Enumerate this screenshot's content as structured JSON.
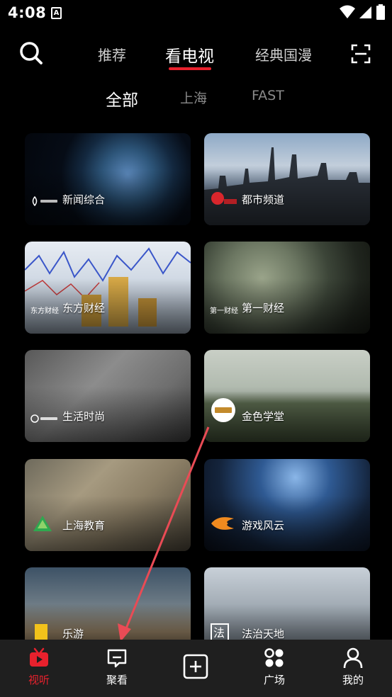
{
  "status": {
    "time": "4:08",
    "notif_letter": "A",
    "icons": [
      "wifi-icon",
      "signal-icon",
      "battery-icon"
    ]
  },
  "top_nav": {
    "tabs": [
      {
        "label": "推荐",
        "active": false
      },
      {
        "label": "看电视",
        "active": true
      },
      {
        "label": "经典国漫",
        "active": false
      }
    ],
    "accent": "#e8212d"
  },
  "sub_nav": {
    "tabs": [
      {
        "label": "全部",
        "active": true
      },
      {
        "label": "上海",
        "active": false
      },
      {
        "label": "FAST",
        "active": false
      }
    ]
  },
  "channels": [
    {
      "name": "新闻综合",
      "logo_text": "新闻综合"
    },
    {
      "name": "都市频道",
      "logo_text": "都市"
    },
    {
      "name": "东方财经",
      "logo_text": "东方财经"
    },
    {
      "name": "第一财经",
      "logo_text": "第一财经"
    },
    {
      "name": "生活时尚",
      "logo_text": "生活时尚"
    },
    {
      "name": "金色学堂",
      "logo_text": "金色学堂"
    },
    {
      "name": "上海教育",
      "logo_text": ""
    },
    {
      "name": "游戏风云",
      "logo_text": ""
    },
    {
      "name": "乐游",
      "logo_text": ""
    },
    {
      "name": "法治天地",
      "logo_text": "法"
    }
  ],
  "bottom_nav": [
    {
      "label": "视听",
      "active": true,
      "icon": "tv-icon"
    },
    {
      "label": "聚看",
      "active": false,
      "icon": "chat-icon"
    },
    {
      "label": "",
      "active": false,
      "icon": "add-icon"
    },
    {
      "label": "广场",
      "active": false,
      "icon": "plaza-icon"
    },
    {
      "label": "我的",
      "active": false,
      "icon": "profile-icon"
    }
  ]
}
